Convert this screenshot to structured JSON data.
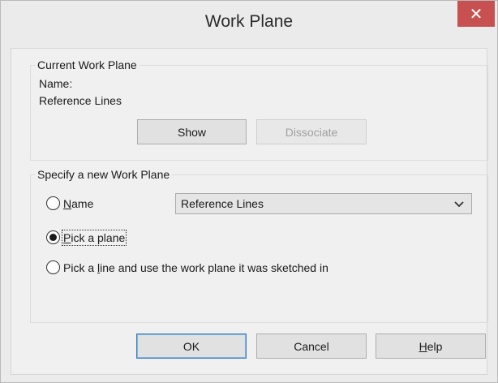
{
  "window": {
    "title": "Work Plane",
    "close_glyph": "✕"
  },
  "current_group": {
    "title": "Current Work Plane",
    "name_label": "Name:",
    "name_value": "Reference Lines",
    "show_label": "Show",
    "dissociate_label": "Dissociate"
  },
  "new_group": {
    "title": "Specify a new Work Plane",
    "name_option": {
      "pre": "",
      "accel": "N",
      "post": "ame",
      "selected": false
    },
    "name_select_value": "Reference Lines",
    "pick_plane_option": {
      "pre": "",
      "accel": "P",
      "post": "ick a plane",
      "selected": true
    },
    "pick_line_option": {
      "pre": "Pick a ",
      "accel": "l",
      "post": "ine and use the work plane it was sketched in",
      "selected": false
    }
  },
  "buttons": {
    "ok": "OK",
    "cancel": "Cancel",
    "help_accel": "H",
    "help_rest": "elp"
  },
  "colors": {
    "close_button": "#c75050",
    "default_button_border": "#3c7fb1"
  }
}
